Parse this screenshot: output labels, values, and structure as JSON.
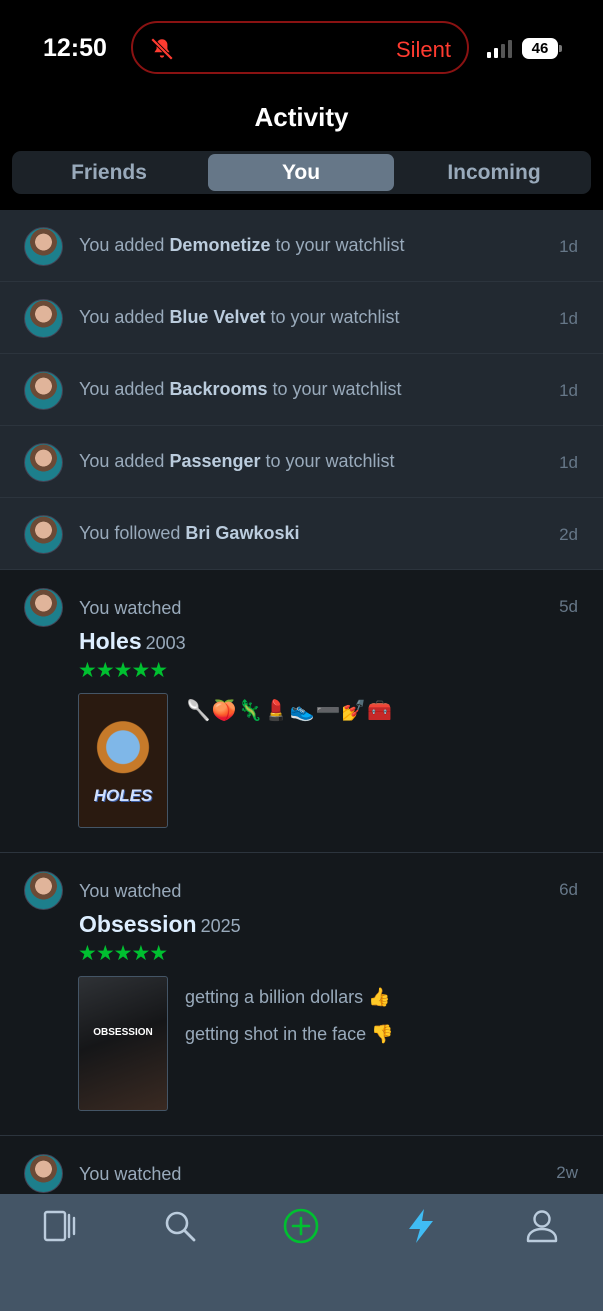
{
  "status": {
    "time": "12:50",
    "silent_label": "Silent",
    "battery": "46"
  },
  "header": {
    "title": "Activity"
  },
  "tabs": [
    {
      "label": "Friends",
      "active": false
    },
    {
      "label": "You",
      "active": true
    },
    {
      "label": "Incoming",
      "active": false
    }
  ],
  "activity_rows": [
    {
      "prefix": "You added ",
      "title": "Demonetize",
      "suffix": " to your watchlist",
      "time": "1d"
    },
    {
      "prefix": "You added ",
      "title": "Blue Velvet",
      "suffix": " to your watchlist",
      "time": "1d"
    },
    {
      "prefix": "You added ",
      "title": "Backrooms",
      "suffix": " to your watchlist",
      "time": "1d"
    },
    {
      "prefix": "You added ",
      "title": "Passenger",
      "suffix": " to your watchlist",
      "time": "1d"
    },
    {
      "prefix": "You followed ",
      "title": "Bri Gawkoski",
      "suffix": "",
      "time": "2d"
    }
  ],
  "watched_cards": [
    {
      "label": "You watched",
      "time": "5d",
      "film": "Holes",
      "year": "2003",
      "stars": "★★★★★",
      "rating": 5,
      "poster_text": "HOLES",
      "review_emojis": "🥄🍑🦎💄👟➖💅🧰"
    },
    {
      "label": "You watched",
      "time": "6d",
      "film": "Obsession",
      "year": "2025",
      "stars": "★★★★★",
      "rating": 5,
      "poster_text": "OBSESSION",
      "review_lines": [
        "getting a billion dollars 👍",
        "getting shot in the face 👎"
      ]
    },
    {
      "label": "You watched",
      "time": "2w"
    }
  ],
  "tab_bar": [
    {
      "icon": "films-icon"
    },
    {
      "icon": "search-icon"
    },
    {
      "icon": "add-icon",
      "color": "#00c030"
    },
    {
      "icon": "activity-icon",
      "color": "#40bcf4",
      "active": true
    },
    {
      "icon": "profile-icon"
    }
  ]
}
